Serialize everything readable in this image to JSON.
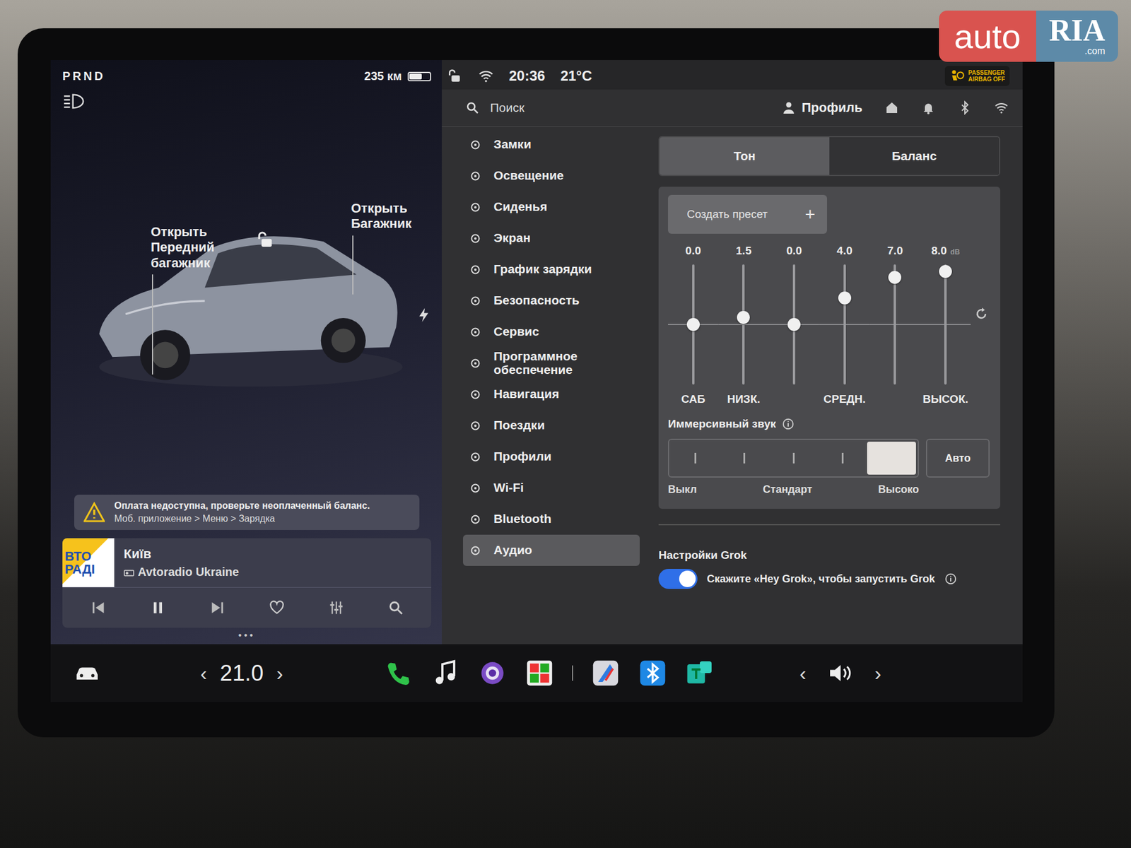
{
  "watermark": {
    "brand": "auto",
    "mark": "RIA",
    "domain": ".com"
  },
  "vehicle": {
    "gears": "PRND",
    "range": "235 км",
    "battery_level": 0.62,
    "callouts": [
      {
        "label": "Открыть Передний багажник"
      },
      {
        "label": "Открыть Багажник"
      }
    ]
  },
  "warning": {
    "line1": "Оплата недоступна, проверьте неоплаченный баланс.",
    "line2": "Моб. приложение > Меню > Зарядка"
  },
  "media": {
    "logo_top": "ВТО",
    "logo_bottom": "РАДІ",
    "title": "Київ",
    "source": "Avtoradio Ukraine",
    "liked": false,
    "playing": true
  },
  "pager": "•••",
  "status": {
    "time": "20:36",
    "temperature": "21°C",
    "airbag_line1": "PASSENGER",
    "airbag_line2": "AIRBAG OFF"
  },
  "search": {
    "placeholder": "Поиск"
  },
  "profile": {
    "label": "Профиль"
  },
  "menu": [
    {
      "label": "Замки",
      "selected": false
    },
    {
      "label": "Освещение",
      "selected": false
    },
    {
      "label": "Сиденья",
      "selected": false
    },
    {
      "label": "Экран",
      "selected": false
    },
    {
      "label": "График зарядки",
      "selected": false
    },
    {
      "label": "Безопасность",
      "selected": false
    },
    {
      "label": "Сервис",
      "selected": false
    },
    {
      "label": "Программное обеспечение",
      "selected": false
    },
    {
      "label": "Навигация",
      "selected": false
    },
    {
      "label": "Поездки",
      "selected": false
    },
    {
      "label": "Профили",
      "selected": false
    },
    {
      "label": "Wi-Fi",
      "selected": false
    },
    {
      "label": "Bluetooth",
      "selected": false
    },
    {
      "label": "Аудио",
      "selected": true
    }
  ],
  "tabs": [
    {
      "label": "Тон",
      "selected": true
    },
    {
      "label": "Баланс",
      "selected": false
    }
  ],
  "preset": {
    "label": "Создать пресет",
    "icon": "+"
  },
  "equalizer": {
    "unit": "dB",
    "bands": [
      {
        "value": "0.0",
        "level": 0.5,
        "label": "САБ"
      },
      {
        "value": "1.5",
        "level": 0.56,
        "label": "НИЗК."
      },
      {
        "value": "0.0",
        "level": 0.5,
        "label": ""
      },
      {
        "value": "4.0",
        "level": 0.72,
        "label": "СРЕДН."
      },
      {
        "value": "7.0",
        "level": 0.89,
        "label": ""
      },
      {
        "value": "8.0",
        "level": 0.94,
        "label": "ВЫСОК."
      }
    ]
  },
  "immersive": {
    "title": "Иммерсивный звук",
    "stops": [
      {
        "selected": false
      },
      {
        "selected": false
      },
      {
        "selected": false
      },
      {
        "selected": false
      },
      {
        "selected": true
      }
    ],
    "auto": {
      "label": "Авто",
      "selected": false
    },
    "scale": [
      "Выкл",
      "Стандарт",
      "Высоко"
    ]
  },
  "grok": {
    "title": "Настройки Grok",
    "enabled": true,
    "hint": "Скажите «Hey Grok», чтобы запустить Grok"
  },
  "climate": {
    "temperature": "21.0",
    "decrease": "‹",
    "increase": "›"
  },
  "volume": {
    "decrease": "‹",
    "increase": "›"
  }
}
